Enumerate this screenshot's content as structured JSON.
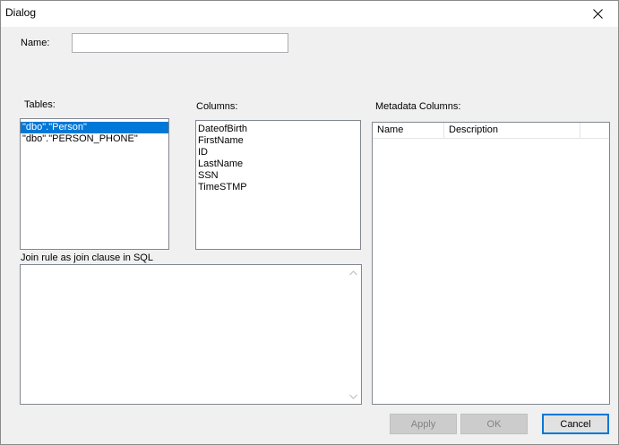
{
  "window": {
    "title": "Dialog"
  },
  "form": {
    "name_label": "Name:",
    "name_value": "",
    "tables_label": "Tables:",
    "columns_label": "Columns:",
    "metadata_label": "Metadata Columns:",
    "join_label": "Join rule as join clause in SQL",
    "join_value": ""
  },
  "tables": [
    {
      "label": "\"dbo\".\"Person\"",
      "selected": true
    },
    {
      "label": "\"dbo\".\"PERSON_PHONE\"",
      "selected": false
    }
  ],
  "columns": [
    "DateofBirth",
    "FirstName",
    "ID",
    "LastName",
    "SSN",
    "TimeSTMP"
  ],
  "metadata_columns": {
    "headers": [
      "Name",
      "Description"
    ],
    "rows": []
  },
  "buttons": {
    "apply": "Apply",
    "ok": "OK",
    "cancel": "Cancel"
  },
  "colors": {
    "selection": "#0078d7",
    "dialog_bg": "#f0f0f0"
  }
}
